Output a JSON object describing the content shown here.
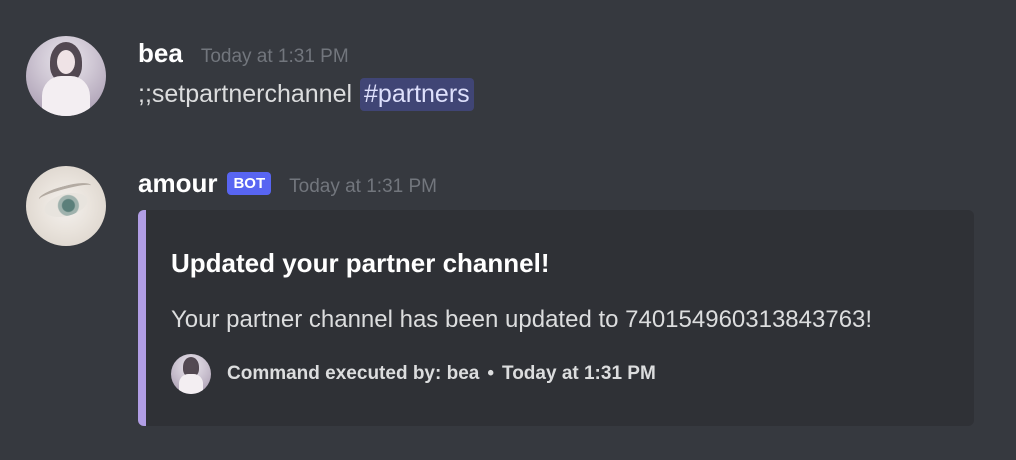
{
  "messages": [
    {
      "username": "bea",
      "timestamp": "Today at 1:31 PM",
      "content_text": ";;setpartnerchannel",
      "mention": "#partners"
    },
    {
      "username": "amour",
      "bot_tag": "BOT",
      "timestamp": "Today at 1:31 PM",
      "embed": {
        "title": "Updated your partner channel!",
        "description": "Your partner channel has been updated to 740154960313843763!",
        "footer_text": "Command executed by: bea",
        "footer_separator": "•",
        "footer_timestamp": "Today at 1:31 PM",
        "accent_color": "#b19ee5"
      }
    }
  ],
  "colors": {
    "background": "#36393f",
    "embed_background": "#2f3136",
    "bot_tag": "#5865f2",
    "mention_text": "#dee0fc"
  }
}
